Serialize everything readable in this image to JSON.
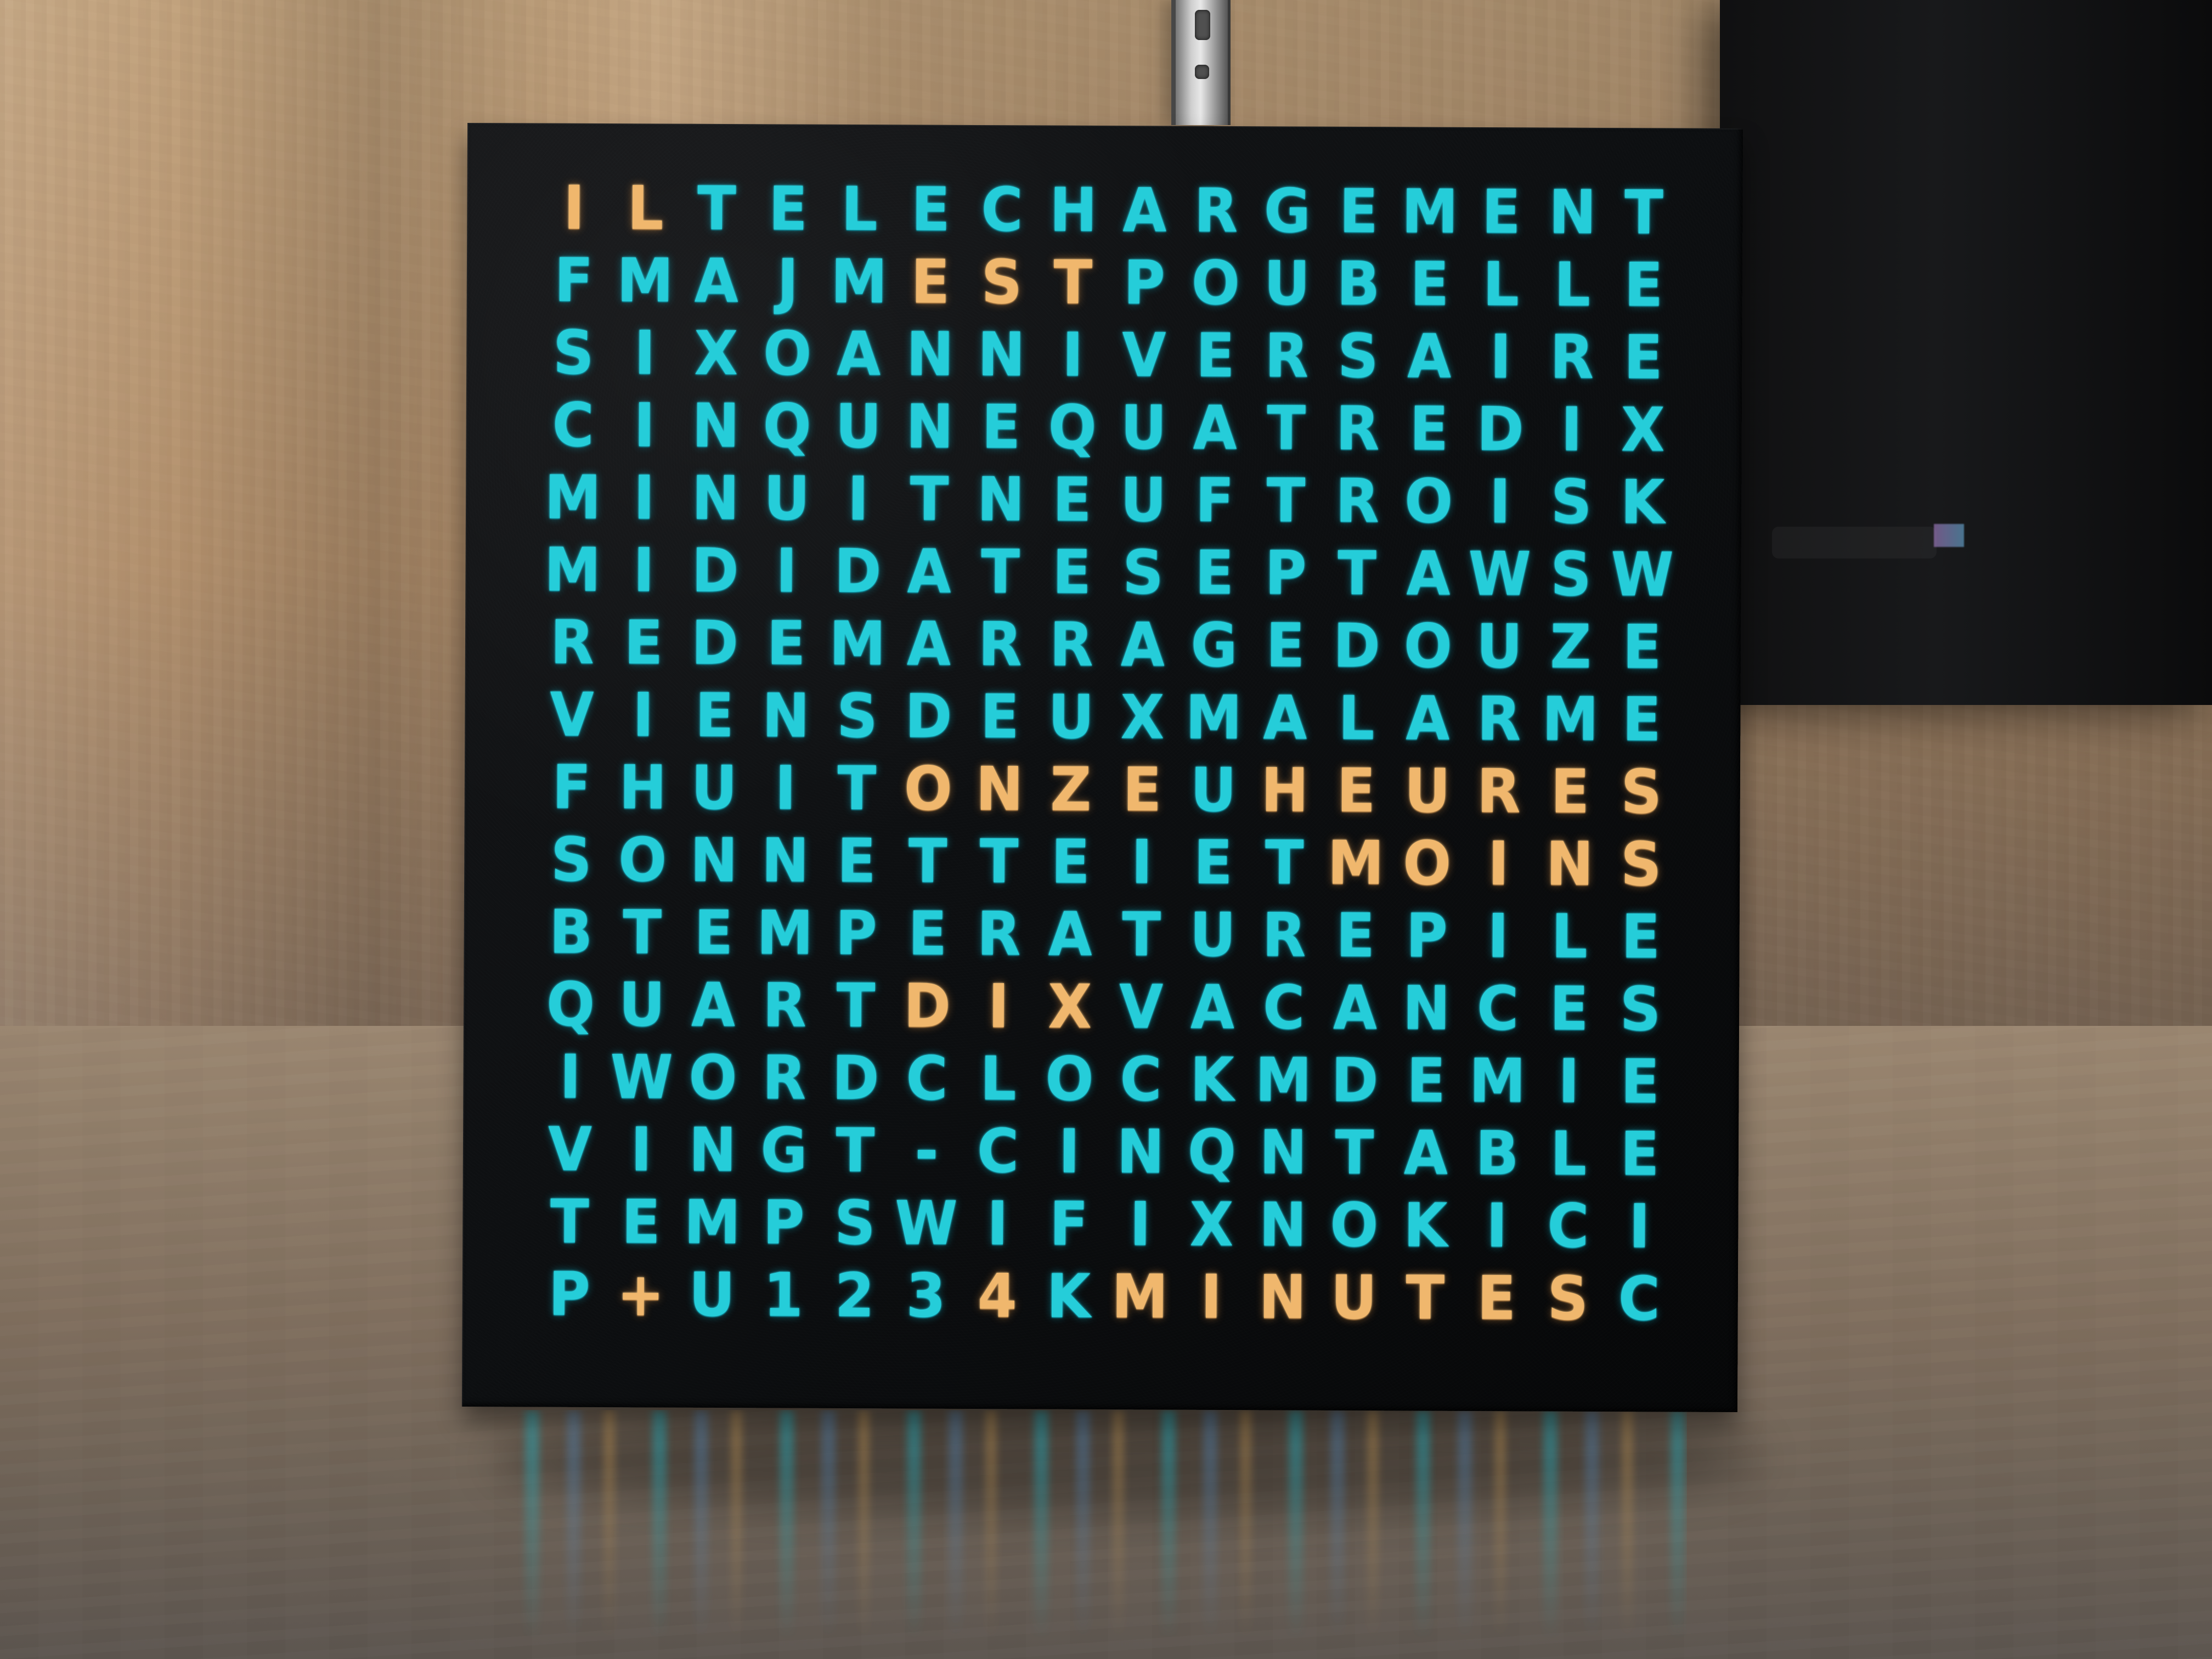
{
  "clock": {
    "rows": [
      {
        "letters": [
          "I",
          "L",
          "T",
          "E",
          "L",
          "E",
          "C",
          "H",
          "A",
          "R",
          "G",
          "E",
          "M",
          "E",
          "N",
          "T"
        ]
      },
      {
        "letters": [
          "F",
          "M",
          "A",
          "J",
          "M",
          "E",
          "S",
          "T",
          "P",
          "O",
          "U",
          "B",
          "E",
          "L",
          "L",
          "E"
        ]
      },
      {
        "letters": [
          "S",
          "I",
          "X",
          "O",
          "A",
          "N",
          "N",
          "I",
          "V",
          "E",
          "R",
          "S",
          "A",
          "I",
          "R",
          "E"
        ]
      },
      {
        "letters": [
          "C",
          "I",
          "N",
          "Q",
          "U",
          "N",
          "E",
          "Q",
          "U",
          "A",
          "T",
          "R",
          "E",
          "D",
          "I",
          "X"
        ]
      },
      {
        "letters": [
          "M",
          "I",
          "N",
          "U",
          "I",
          "T",
          "N",
          "E",
          "U",
          "F",
          "T",
          "R",
          "O",
          "I",
          "S",
          "K"
        ]
      },
      {
        "letters": [
          "M",
          "I",
          "D",
          "I",
          "D",
          "A",
          "T",
          "E",
          "S",
          "E",
          "P",
          "T",
          "A",
          "W",
          "S",
          "W"
        ]
      },
      {
        "letters": [
          "R",
          "E",
          "D",
          "E",
          "M",
          "A",
          "R",
          "R",
          "A",
          "G",
          "E",
          "D",
          "O",
          "U",
          "Z",
          "E"
        ]
      },
      {
        "letters": [
          "V",
          "I",
          "E",
          "N",
          "S",
          "D",
          "E",
          "U",
          "X",
          "M",
          "A",
          "L",
          "A",
          "R",
          "M",
          "E"
        ]
      },
      {
        "letters": [
          "F",
          "H",
          "U",
          "I",
          "T",
          "O",
          "N",
          "Z",
          "E",
          "U",
          "H",
          "E",
          "U",
          "R",
          "E",
          "S"
        ]
      },
      {
        "letters": [
          "S",
          "O",
          "N",
          "N",
          "E",
          "T",
          "T",
          "E",
          "I",
          "E",
          "T",
          "M",
          "O",
          "I",
          "N",
          "S"
        ]
      },
      {
        "letters": [
          "B",
          "T",
          "E",
          "M",
          "P",
          "E",
          "R",
          "A",
          "T",
          "U",
          "R",
          "E",
          "P",
          "I",
          "L",
          "E"
        ]
      },
      {
        "letters": [
          "Q",
          "U",
          "A",
          "R",
          "T",
          "D",
          "I",
          "X",
          "V",
          "A",
          "C",
          "A",
          "N",
          "C",
          "E",
          "S"
        ]
      },
      {
        "letters": [
          "I",
          "W",
          "O",
          "R",
          "D",
          "C",
          "L",
          "O",
          "C",
          "K",
          "M",
          "D",
          "E",
          "M",
          "I",
          "E"
        ]
      },
      {
        "letters": [
          "V",
          "I",
          "N",
          "G",
          "T",
          "-",
          "C",
          "I",
          "N",
          "Q",
          "N",
          "T",
          "A",
          "B",
          "L",
          "E"
        ]
      },
      {
        "letters": [
          "T",
          "E",
          "M",
          "P",
          "S",
          "W",
          "I",
          "F",
          "I",
          "X",
          "N",
          "O",
          "K",
          "I",
          "C",
          "I"
        ]
      },
      {
        "letters": [
          "P",
          "+",
          "U",
          "1",
          "2",
          "3",
          "4",
          "K",
          "M",
          "I",
          "N",
          "U",
          "T",
          "E",
          "S",
          "C"
        ]
      }
    ],
    "active": {
      "0": [
        0,
        1
      ],
      "1": [
        5,
        6,
        7
      ],
      "8": [
        5,
        6,
        7,
        8,
        10,
        11,
        12,
        13,
        14,
        15
      ],
      "9": [
        11,
        12,
        13,
        14,
        15
      ],
      "11": [
        5,
        6,
        7
      ],
      "15": [
        1,
        6,
        8,
        9,
        10,
        11,
        12,
        13,
        14
      ]
    },
    "colors": {
      "cyan": "#25cdd9",
      "amber": "#f0b76d",
      "panel": "#0f1012"
    }
  }
}
